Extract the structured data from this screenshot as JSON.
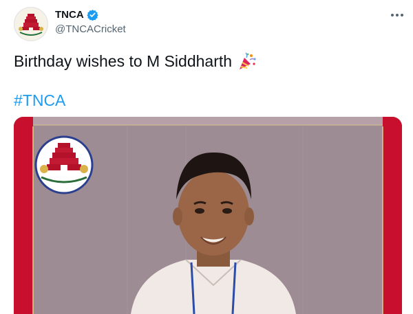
{
  "account": {
    "display_name": "TNCA",
    "handle": "@TNCACricket",
    "verified": true,
    "avatar_icon": "tnca-logo-icon"
  },
  "tweet": {
    "text": "Birthday wishes to M Siddharth",
    "emoji_icon": "party-popper-icon",
    "hashtag": "#TNCA",
    "more_icon": "more-options-icon"
  },
  "media": {
    "type": "photo",
    "logo_icon": "tnca-logo-icon",
    "frame_color": "#c8102e",
    "background_color": "#9d8c93"
  },
  "colors": {
    "link": "#1d9bf0",
    "verified": "#1d9bf0",
    "secondary_text": "#536471"
  }
}
